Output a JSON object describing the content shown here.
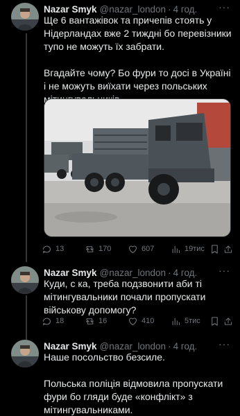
{
  "tweets": [
    {
      "name": "Nazar Smyk",
      "handle": "@nazar_london",
      "time": "4 год.",
      "text": "Ще 6 вантажівок та причепів стоять у Нідерландах вже 2 тиждні бо перевізники тупо не можуть їх забрати.\n\nВгадайте чому? Бо фури то досі в Україні і не можуть виїхати через польських мітингувальників.",
      "stats": {
        "replies": "13",
        "retweets": "170",
        "likes": "607",
        "views": "19тис"
      }
    },
    {
      "name": "Nazar Smyk",
      "handle": "@nazar_london",
      "time": "4 год.",
      "text": "Куди, с  ка, треба подзвонити аби ті мітингувальники почали пропускати військову допомогу?",
      "stats": {
        "replies": "18",
        "retweets": "16",
        "likes": "410",
        "views": "5тис"
      }
    },
    {
      "name": "Nazar Smyk",
      "handle": "@nazar_london",
      "time": "4 год.",
      "text": "Наше посольство безсиле.\n\nПольська поліція відмовила пропускати фури бо гляди буде «конфлікт» з мітингувальниками."
    }
  ],
  "icons": {
    "more": "more-icon",
    "reply": "reply-icon",
    "retweet": "retweet-icon",
    "like": "heart-icon",
    "views": "views-icon",
    "bookmark": "bookmark-icon",
    "share": "share-icon"
  },
  "colors": {
    "background": "#000000",
    "text": "#e7e9ea",
    "secondary": "#71767b",
    "truck": "#4f575d"
  }
}
